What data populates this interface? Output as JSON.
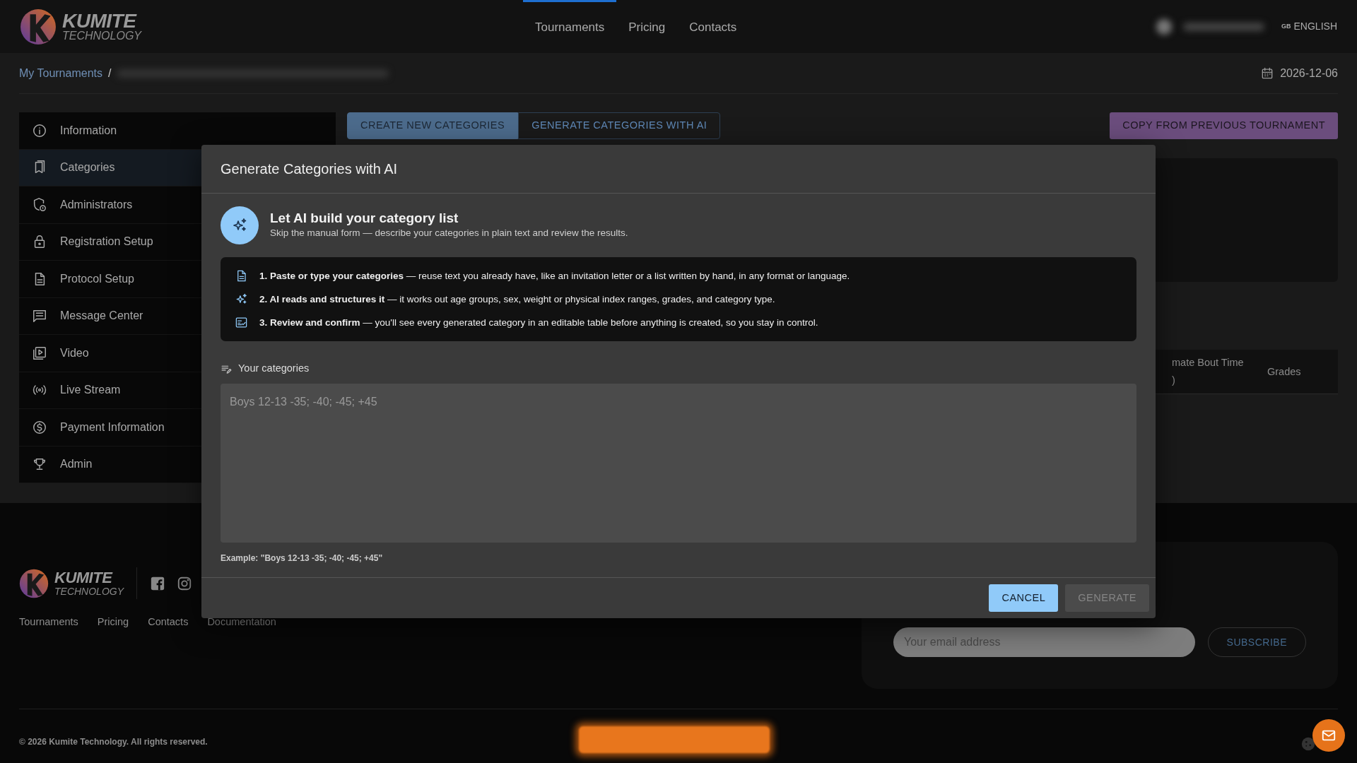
{
  "header": {
    "logo": {
      "name": "KUMITE",
      "tagline": "TECHNOLOGY"
    },
    "nav": [
      {
        "label": "Tournaments",
        "selected": true
      },
      {
        "label": "Pricing",
        "selected": false
      },
      {
        "label": "Contacts",
        "selected": false
      }
    ],
    "language": {
      "flag": "GB",
      "label": "ENGLISH"
    }
  },
  "breadcrumb": {
    "items": [
      "My Tournaments"
    ],
    "separator": "/",
    "date": "2026-12-06"
  },
  "sidebar": {
    "items": [
      {
        "label": "Information",
        "selected": false
      },
      {
        "label": "Categories",
        "selected": true
      },
      {
        "label": "Administrators",
        "selected": false
      },
      {
        "label": "Registration Setup",
        "selected": false
      },
      {
        "label": "Protocol Setup",
        "selected": false
      },
      {
        "label": "Message Center",
        "selected": false
      },
      {
        "label": "Video",
        "selected": false
      },
      {
        "label": "Live Stream",
        "selected": false
      },
      {
        "label": "Payment Information",
        "selected": false
      },
      {
        "label": "Admin",
        "selected": false
      }
    ]
  },
  "tabs": [
    {
      "label": "CREATE NEW CATEGORIES",
      "selected": true
    },
    {
      "label": "GENERATE CATEGORIES WITH AI",
      "selected": false
    }
  ],
  "copy_button": "COPY FROM PREVIOUS TOURNAMENT",
  "table": {
    "columns": [
      {
        "lines": [
          "mate Bout Time",
          ")"
        ]
      },
      {
        "lines": [
          "Grades"
        ]
      }
    ]
  },
  "modal": {
    "title": "Generate Categories with AI",
    "intro": {
      "heading": "Let AI build your category list",
      "text": "Skip the manual form — describe your categories in plain text and review the results."
    },
    "steps": [
      {
        "text": "**1. Paste or type your categories** — reuse text you already have, like an invitation letter or a list written by hand, in any format or language."
      },
      {
        "text": "**2. AI reads and structures it** — it works out age groups, sex, weight or physical index ranges, grades, and category type."
      },
      {
        "text": "**3. Review and confirm** — you'll see every generated category in an editable table before anything is created, so you stay in control."
      }
    ],
    "field": {
      "label": "Your categories",
      "placeholder": "Boys 12-13 -35; -40; -45; +45"
    },
    "example": "Example: \"Boys 12-13 -35; -40; -45; +45\"",
    "buttons": [
      {
        "label": "CANCEL",
        "disabled": false
      },
      {
        "label": "GENERATE",
        "disabled": true
      }
    ]
  },
  "footer": {
    "logo": {
      "name": "KUMITE",
      "tagline": "TECHNOLOGY"
    },
    "links": [
      "Tournaments",
      "Pricing",
      "Contacts",
      "Documentation"
    ],
    "newsletter": {
      "placeholder": "Your email address",
      "button": "SUBSCRIBE"
    },
    "copyright": "© 2026 Kumite Technology. All rights reserved."
  }
}
